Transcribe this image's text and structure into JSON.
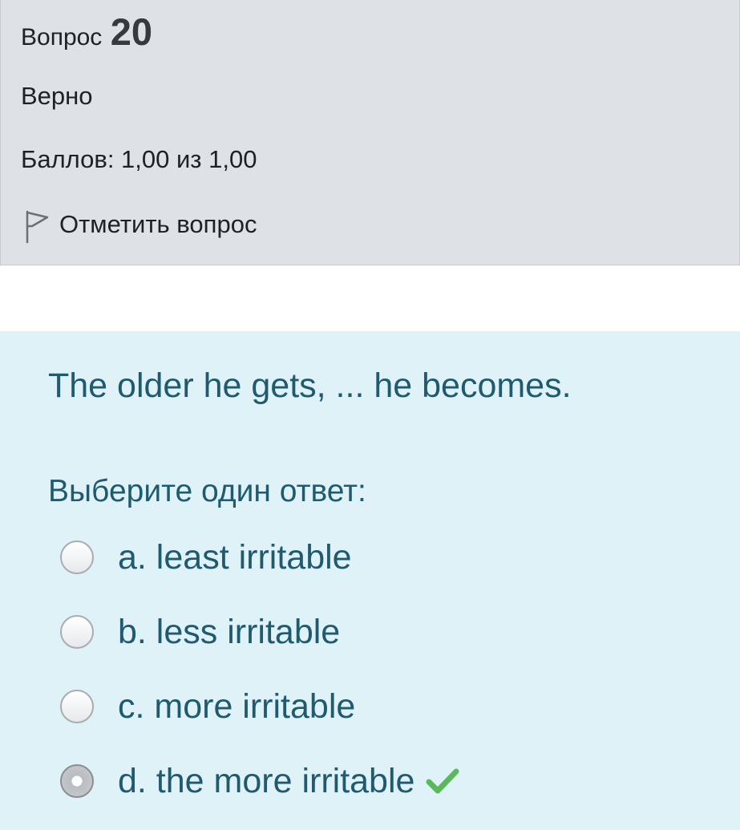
{
  "info": {
    "question_label": "Вопрос",
    "question_number": "20",
    "state": "Верно",
    "grade": "Баллов: 1,00 из 1,00",
    "flag_label": "Отметить вопрос"
  },
  "question": {
    "text": "The older he gets, ... he becomes.",
    "prompt": "Выберите один ответ:",
    "answers": [
      {
        "label": "a. least irritable",
        "selected": false,
        "correct": false
      },
      {
        "label": "b. less irritable",
        "selected": false,
        "correct": false
      },
      {
        "label": "c. more irritable",
        "selected": false,
        "correct": false
      },
      {
        "label": "d. the more irritable",
        "selected": true,
        "correct": true
      }
    ]
  },
  "icons": {
    "flag": "flag-outline-icon",
    "correct": "checkmark-icon"
  },
  "colors": {
    "info_background": "#dee2e6",
    "content_background": "#def2f8",
    "question_text": "#1f5a6e",
    "correct_check": "#5cb85c"
  }
}
